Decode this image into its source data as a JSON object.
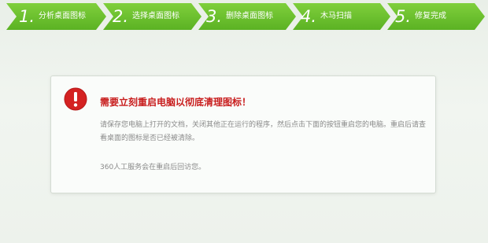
{
  "steps": [
    {
      "number": "1.",
      "label": "分析桌面图标"
    },
    {
      "number": "2.",
      "label": "选择桌面图标"
    },
    {
      "number": "3.",
      "label": "删除桌面图标"
    },
    {
      "number": "4.",
      "label": "木马扫描"
    },
    {
      "number": "5.",
      "label": "修复完成"
    }
  ],
  "dialog": {
    "icon": "exclamation-alert-icon",
    "title": "需要立刻重启电脑以彻底清理图标！",
    "message": "请保存您电脑上打开的文档，关闭其他正在运行的程序，然后点击下面的按钮重启您的电脑。重启后请查看桌面的图标是否已经被清除。",
    "note": "360人工服务会在重启后回访您。"
  },
  "colors": {
    "step_green": "#6cc02f",
    "step_dark": "#4f9a1d",
    "alert_red": "#c81d1d",
    "text_gray": "#8a8a8a"
  }
}
